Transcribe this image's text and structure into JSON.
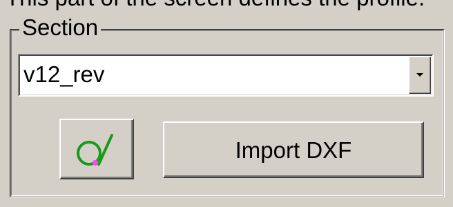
{
  "caption": "This part of the screen defines the profile.",
  "section": {
    "title": "Section",
    "combo": {
      "value": "v12_rev"
    },
    "buttons": {
      "import_label": "Import DXF"
    },
    "icons": {
      "profile_tool": "circle-line-profile-icon",
      "dropdown": "chevron-down-icon"
    },
    "colors": {
      "background": "#d4d0c8",
      "icon_stroke": "#1a9a1a",
      "icon_point": "#ff40ff"
    }
  }
}
